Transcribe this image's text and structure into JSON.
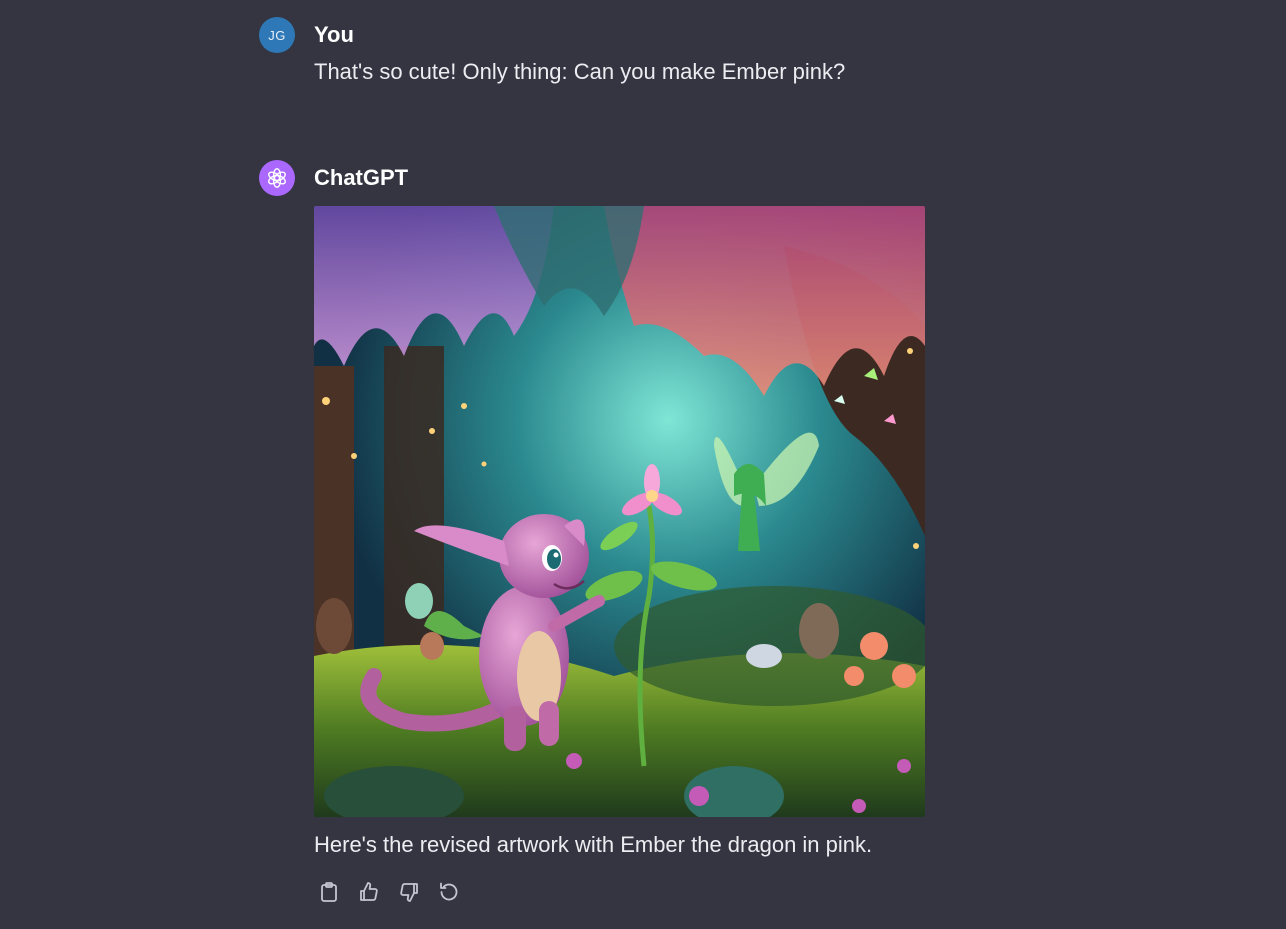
{
  "messages": [
    {
      "role": "user",
      "author": "You",
      "avatar_initials": "JG",
      "text": "That's so cute! Only thing: Can you make Ember pink?"
    },
    {
      "role": "assistant",
      "author": "ChatGPT",
      "avatar_icon": "openai-logo-icon",
      "image": {
        "subject": "pink dragon in enchanted forest with fairy"
      },
      "text": "Here's the revised artwork with Ember the dragon in pink."
    }
  ],
  "actions": [
    {
      "icon": "clipboard-icon"
    },
    {
      "icon": "thumbs-up-icon"
    },
    {
      "icon": "thumbs-down-icon"
    },
    {
      "icon": "regenerate-icon"
    }
  ],
  "colors": {
    "background": "#343541",
    "user_avatar": "#2f78b7",
    "assistant_avatar": "#ab68ff",
    "text": "#ececf1"
  }
}
